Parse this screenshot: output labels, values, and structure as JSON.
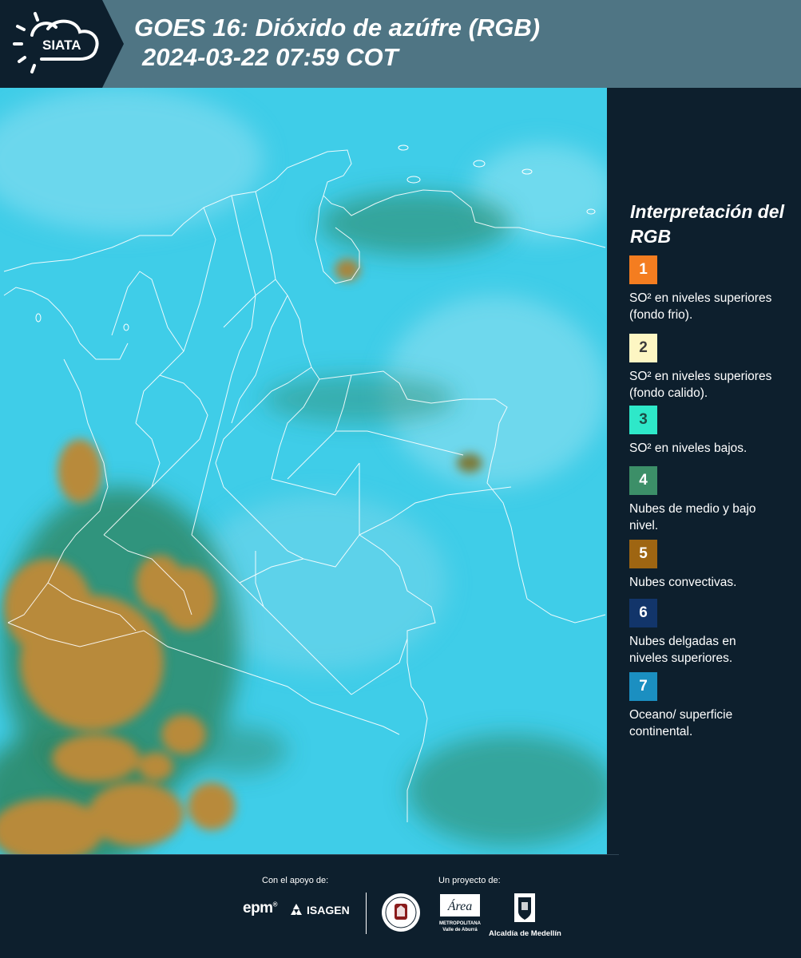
{
  "header": {
    "title_line1": "GOES 16: Dióxido de azúfre (RGB)",
    "title_line2": "2024-03-22 07:59 COT",
    "logo_text": "SIATA"
  },
  "map": {
    "background_color": "#3fcde8",
    "convective_color": "#b88a3a",
    "midlow_cloud_color": "#2f8a6a",
    "border_color": "#ffffff"
  },
  "legend": {
    "title": "Interpretación del RGB",
    "items": [
      {
        "number": "1",
        "color": "#f47d20",
        "text_color": "#ffffff",
        "label": "SO² en niveles superiores (fondo frio)."
      },
      {
        "number": "2",
        "color": "#fdf6c3",
        "text_color": "#3a3a3a",
        "label": "SO² en niveles superiores (fondo calido)."
      },
      {
        "number": "3",
        "color": "#2ee8c9",
        "text_color": "#1c4d46",
        "label": "SO² en niveles bajos."
      },
      {
        "number": "4",
        "color": "#3c8f68",
        "text_color": "#ffffff",
        "label": "Nubes de medio y bajo nivel."
      },
      {
        "number": "5",
        "color": "#9e6512",
        "text_color": "#ffffff",
        "label": "Nubes convectivas."
      },
      {
        "number": "6",
        "color": "#12356a",
        "text_color": "#ffffff",
        "label": "Nubes delgadas en niveles superiores."
      },
      {
        "number": "7",
        "color": "#1b8fc1",
        "text_color": "#ffffff",
        "label": "Oceano/ superficie continental."
      }
    ]
  },
  "footer": {
    "support_label": "Con el apoyo de:",
    "project_label": "Un proyecto de:",
    "sponsor_epm": "epm",
    "sponsor_isagen": "ISAGEN",
    "area_logo_script": "Área",
    "area_logo_line1": "METROPOLITANA",
    "area_logo_line2": "Valle de Aburrá",
    "alcaldia": "Alcaldía de Medellín"
  }
}
